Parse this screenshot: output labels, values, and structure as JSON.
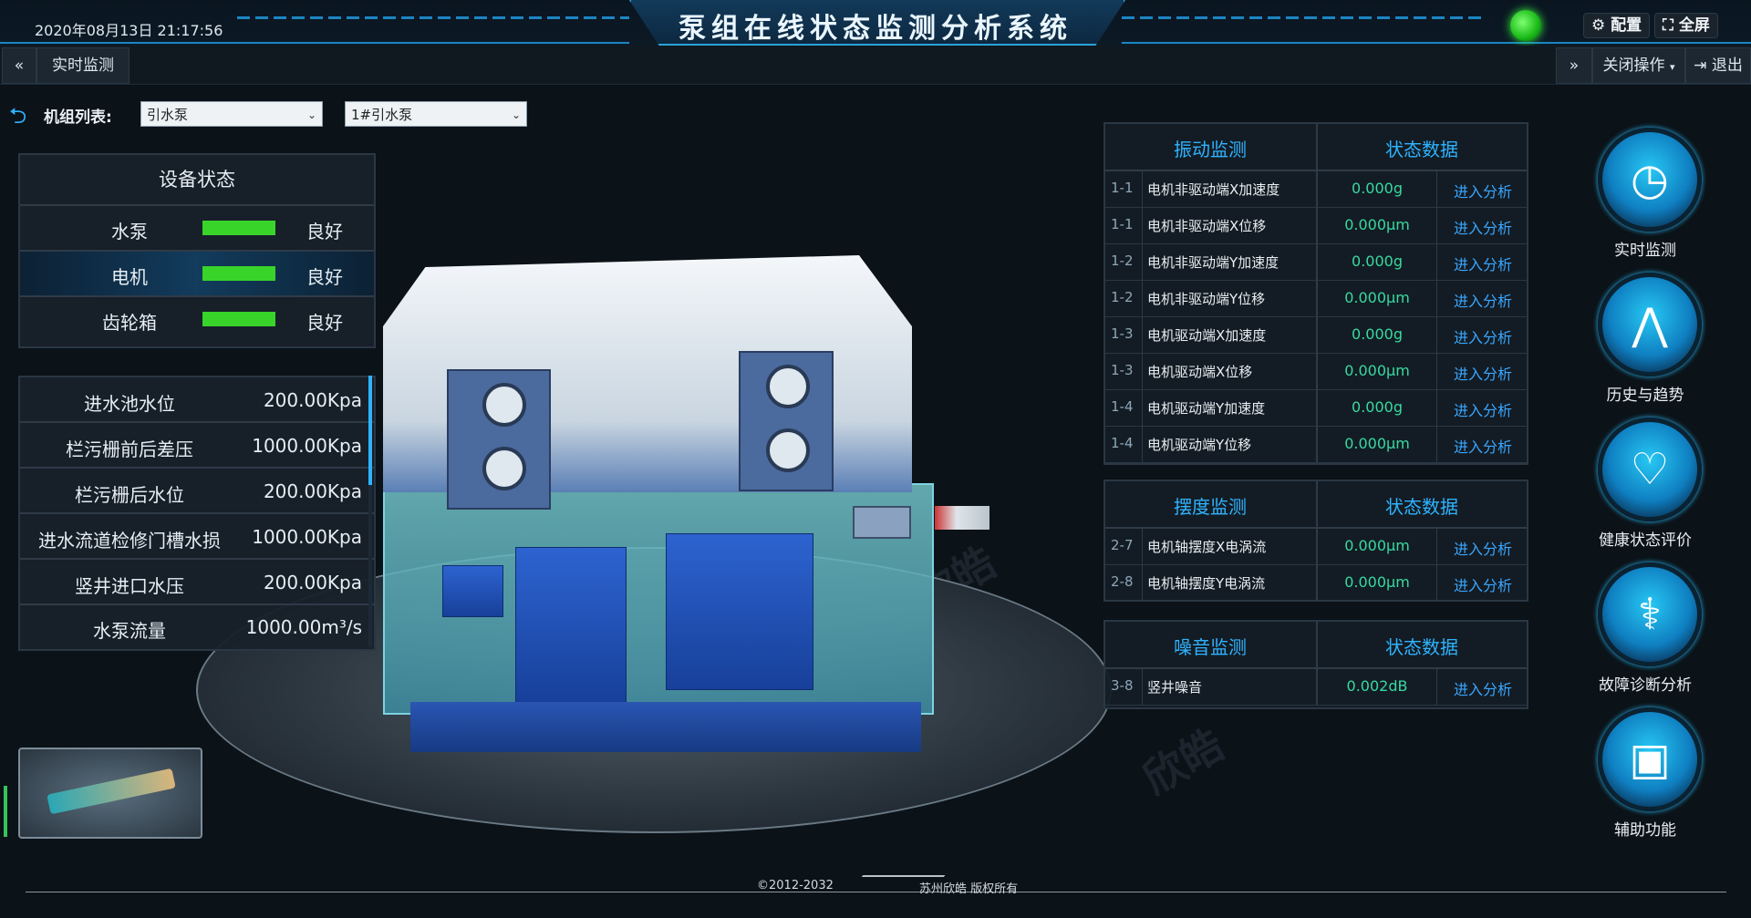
{
  "header": {
    "datetime": "2020年08月13日 21:17:56",
    "title": "泵组在线状态监测分析系统",
    "config_label": "配置",
    "fullscreen_label": "全屏"
  },
  "subbar": {
    "realtime_tab": "实时监测",
    "close_op": "关闭操作",
    "exit": "退出"
  },
  "unit_list": {
    "label": "机组列表:",
    "select1": "引水泵",
    "select2": "1#引水泵"
  },
  "device_status": {
    "title": "设备状态",
    "items": [
      {
        "name": "水泵",
        "state": "良好"
      },
      {
        "name": "电机",
        "state": "良好"
      },
      {
        "name": "齿轮箱",
        "state": "良好"
      }
    ]
  },
  "parameters": [
    {
      "label": "进水池水位",
      "value": "200.00Kpa"
    },
    {
      "label": "栏污栅前后差压",
      "value": "1000.00Kpa"
    },
    {
      "label": "栏污栅后水位",
      "value": "200.00Kpa"
    },
    {
      "label": "进水流道检修门槽水损",
      "value": "1000.00Kpa"
    },
    {
      "label": "竖井进口水压",
      "value": "200.00Kpa"
    },
    {
      "label": "水泵流量",
      "value": "1000.00m³/s"
    }
  ],
  "vibration": {
    "head1": "振动监测",
    "head2": "状态数据",
    "rows": [
      {
        "id": "1-1",
        "name": "电机非驱动端X加速度",
        "value": "0.000g",
        "link": "进入分析"
      },
      {
        "id": "1-1",
        "name": "电机非驱动端X位移",
        "value": "0.000μm",
        "link": "进入分析"
      },
      {
        "id": "1-2",
        "name": "电机非驱动端Y加速度",
        "value": "0.000g",
        "link": "进入分析"
      },
      {
        "id": "1-2",
        "name": "电机非驱动端Y位移",
        "value": "0.000μm",
        "link": "进入分析"
      },
      {
        "id": "1-3",
        "name": "电机驱动端X加速度",
        "value": "0.000g",
        "link": "进入分析"
      },
      {
        "id": "1-3",
        "name": "电机驱动端X位移",
        "value": "0.000μm",
        "link": "进入分析"
      },
      {
        "id": "1-4",
        "name": "电机驱动端Y加速度",
        "value": "0.000g",
        "link": "进入分析"
      },
      {
        "id": "1-4",
        "name": "电机驱动端Y位移",
        "value": "0.000μm",
        "link": "进入分析"
      }
    ]
  },
  "swing": {
    "head1": "摆度监测",
    "head2": "状态数据",
    "rows": [
      {
        "id": "2-7",
        "name": "电机轴摆度X电涡流",
        "value": "0.000μm",
        "link": "进入分析"
      },
      {
        "id": "2-8",
        "name": "电机轴摆度Y电涡流",
        "value": "0.000μm",
        "link": "进入分析"
      }
    ]
  },
  "noise": {
    "head1": "噪音监测",
    "head2": "状态数据",
    "rows": [
      {
        "id": "3-8",
        "name": "竖井噪音",
        "value": "0.002dB",
        "link": "进入分析"
      }
    ]
  },
  "nav": [
    {
      "label": "实时监测",
      "icon": "clock-history-icon"
    },
    {
      "label": "历史与趋势",
      "icon": "trend-line-icon"
    },
    {
      "label": "健康状态评价",
      "icon": "heart-hand-icon"
    },
    {
      "label": "故障诊断分析",
      "icon": "stethoscope-icon"
    },
    {
      "label": "辅助功能",
      "icon": "toolbox-icon"
    }
  ],
  "footer": {
    "copyright": "©2012-2032",
    "company": "苏州欣皓 版权所有"
  },
  "watermark": "欣皓",
  "colors": {
    "accent": "#2fb3ff",
    "good": "#38d42a",
    "value": "#39d9a0",
    "link": "#3aa6ff"
  }
}
